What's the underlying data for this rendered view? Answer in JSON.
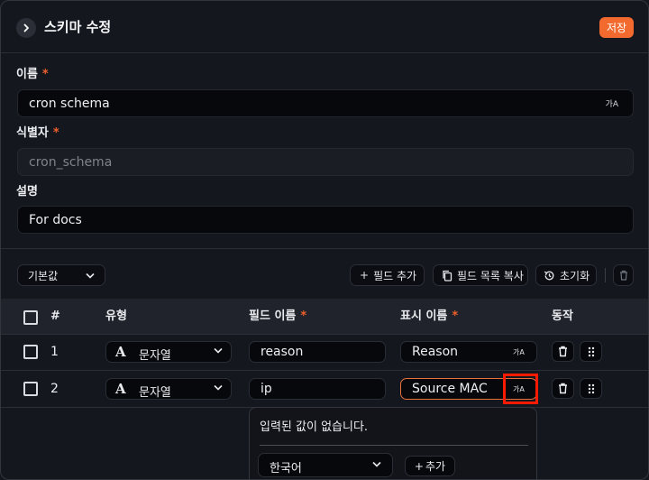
{
  "header": {
    "title": "스키마 수정",
    "save_label": "저장"
  },
  "form": {
    "name_label": "이름",
    "name_value": "cron schema",
    "id_label": "식별자",
    "id_value": "cron_schema",
    "desc_label": "설명",
    "desc_value": "For docs",
    "required_mark": "*",
    "translate_glyph": "가A"
  },
  "toolbar": {
    "preset_label": "기본값",
    "add_field_label": "필드 추가",
    "copy_list_label": "필드 목록 복사",
    "reset_label": "초기화"
  },
  "table": {
    "columns": {
      "num": "#",
      "type": "유형",
      "field": "필드 이름",
      "display": "표시 이름",
      "action": "동작"
    },
    "rows": [
      {
        "num": "1",
        "type": "문자열",
        "field": "reason",
        "display": "Reason"
      },
      {
        "num": "2",
        "type": "문자열",
        "field": "ip",
        "display": "Source MAC"
      }
    ]
  },
  "popover": {
    "message": "입력된 값이 없습니다.",
    "language": "한국어",
    "add_label": "추가"
  },
  "colors": {
    "accent": "#f26a2e",
    "highlight": "#ff1a00",
    "background": "#15171f"
  }
}
